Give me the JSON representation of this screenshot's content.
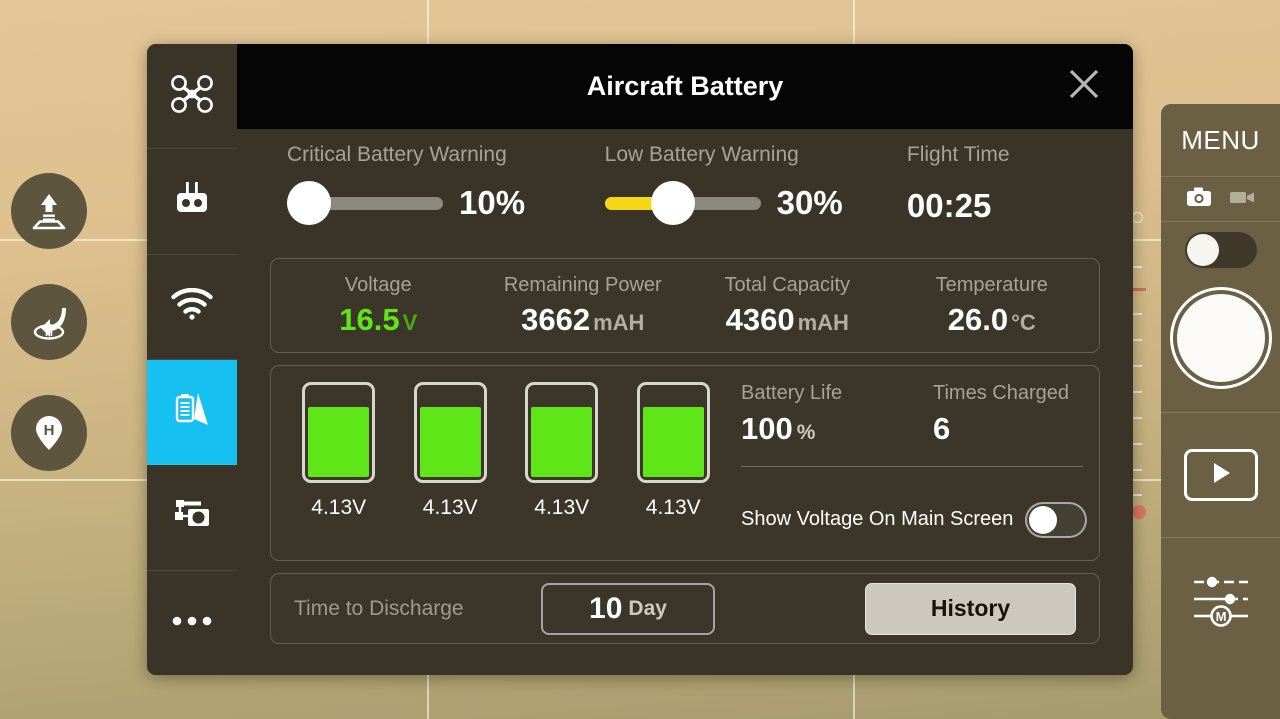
{
  "dialog": {
    "title": "Aircraft Battery",
    "close_icon": "close-icon",
    "warnings": {
      "critical": {
        "label": "Critical Battery Warning",
        "value": "10%",
        "percent": 10
      },
      "low": {
        "label": "Low Battery Warning",
        "value": "30%",
        "percent": 30
      },
      "flight_time": {
        "label": "Flight Time",
        "value": "00:25"
      }
    },
    "stats": [
      {
        "label": "Voltage",
        "value": "16.5",
        "unit": "V",
        "accent": "#5ee619"
      },
      {
        "label": "Remaining Power",
        "value": "3662",
        "unit": "mAH",
        "accent": "#ffffff"
      },
      {
        "label": "Total Capacity",
        "value": "4360",
        "unit": "mAH",
        "accent": "#ffffff"
      },
      {
        "label": "Temperature",
        "value": "26.0",
        "unit": "°C",
        "accent": "#ffffff"
      }
    ],
    "cells": [
      {
        "voltage": "4.13V",
        "level": 79
      },
      {
        "voltage": "4.13V",
        "level": 79
      },
      {
        "voltage": "4.13V",
        "level": 79
      },
      {
        "voltage": "4.13V",
        "level": 79
      }
    ],
    "battery_life": {
      "label": "Battery Life",
      "value": "100",
      "unit": "%"
    },
    "times_charged": {
      "label": "Times Charged",
      "value": "6"
    },
    "show_voltage": {
      "label": "Show Voltage On Main Screen",
      "enabled": false
    },
    "time_to_discharge": {
      "label": "Time to Discharge",
      "value": "10",
      "unit": "Day"
    },
    "history_button": {
      "label": "History"
    },
    "sidebar": [
      {
        "name": "aircraft",
        "icon": "drone-icon",
        "active": false
      },
      {
        "name": "remote-controller",
        "icon": "remote-controller-icon",
        "active": false
      },
      {
        "name": "image-transmission",
        "icon": "wifi-icon",
        "active": false
      },
      {
        "name": "battery",
        "icon": "battery-icon",
        "active": true
      },
      {
        "name": "gimbal",
        "icon": "gimbal-camera-icon",
        "active": false
      },
      {
        "name": "more",
        "icon": "more-dots-icon",
        "active": false
      }
    ]
  },
  "right_panel": {
    "menu_label": "MENU",
    "photo_icon": "camera-icon",
    "video_icon": "video-camera-icon",
    "mode_toggle": {
      "enabled": false
    },
    "shutter_button": "shutter-button",
    "playback_button": "playback-icon",
    "settings_button": "camera-settings-icon",
    "settings_badge": "M"
  },
  "left_controls": [
    {
      "name": "takeoff",
      "icon": "auto-takeoff-icon"
    },
    {
      "name": "return-to-home",
      "icon": "return-to-home-icon"
    },
    {
      "name": "home-point",
      "icon": "home-point-icon"
    }
  ],
  "colors": {
    "accent_cyan": "#16c0f0",
    "battery_green": "#5ee619",
    "warning_yellow": "#f5d715",
    "panel_bg": "#3a3428",
    "header_bg": "#050505"
  }
}
